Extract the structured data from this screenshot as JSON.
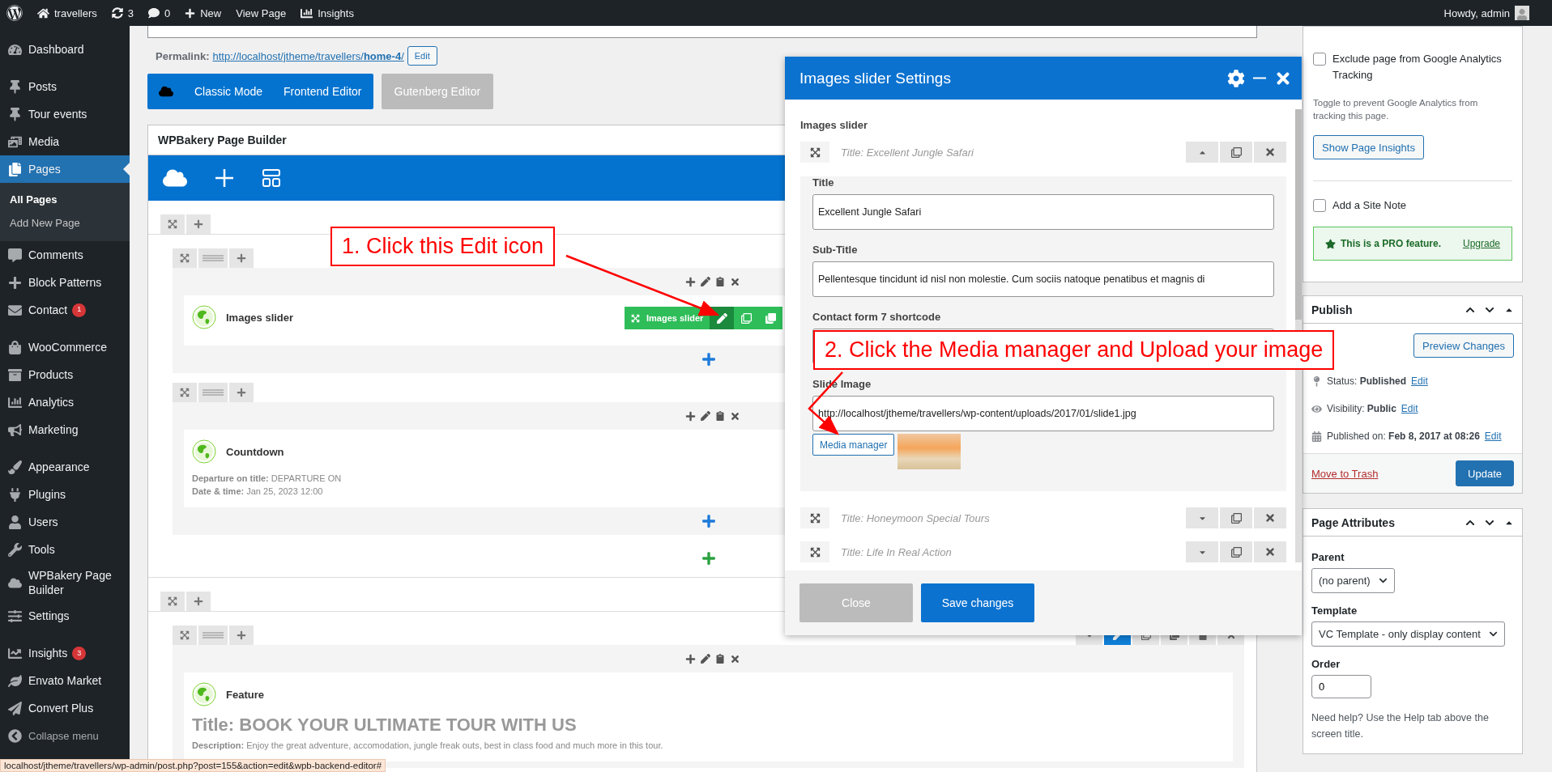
{
  "admin_bar": {
    "site": "travellers",
    "updates": "3",
    "comments": "0",
    "new": "New",
    "view": "View Page",
    "insights": "Insights",
    "greeting": "Howdy, admin"
  },
  "sidebar": {
    "groups": [
      {
        "items": [
          {
            "label": "Dashboard",
            "selected": false
          }
        ]
      },
      {
        "items": [
          {
            "label": "Posts",
            "selected": false
          },
          {
            "label": "Tour events",
            "selected": false
          },
          {
            "label": "Media",
            "selected": false
          },
          {
            "label": "Pages",
            "selected": true,
            "expanded": true,
            "children": [
              {
                "label": "All Pages",
                "selected": true
              },
              {
                "label": "Add New Page",
                "selected": false
              }
            ]
          },
          {
            "label": "Comments",
            "selected": false
          },
          {
            "label": "Block Patterns",
            "selected": false
          },
          {
            "label": "Contact",
            "selected": false,
            "badge": "1"
          }
        ]
      },
      {
        "items": [
          {
            "label": "WooCommerce",
            "selected": false
          },
          {
            "label": "Products",
            "selected": false
          },
          {
            "label": "Analytics",
            "selected": false
          },
          {
            "label": "Marketing",
            "selected": false
          }
        ]
      },
      {
        "items": [
          {
            "label": "Appearance",
            "selected": false
          },
          {
            "label": "Plugins",
            "selected": false
          },
          {
            "label": "Users",
            "selected": false
          },
          {
            "label": "Tools",
            "selected": false
          },
          {
            "label": "WPBakery Page Builder",
            "selected": false
          },
          {
            "label": "Settings",
            "selected": false
          }
        ]
      },
      {
        "items": [
          {
            "label": "Insights",
            "selected": false,
            "badge": "3"
          },
          {
            "label": "Envato Market",
            "selected": false
          },
          {
            "label": "Convert Plus",
            "selected": false
          }
        ]
      }
    ],
    "collapse": "Collapse menu"
  },
  "permalink": {
    "label": "Permalink:",
    "url": "http://localhost/jtheme/travellers/**home-4**/",
    "button": "Edit"
  },
  "mode_buttons": [
    {
      "label": "Classic Mode",
      "kind": "primary"
    },
    {
      "label": "Frontend Editor",
      "kind": "primary"
    },
    {
      "label": "Gutenberg Editor",
      "kind": "secondary"
    }
  ],
  "builder": {
    "title": "WPBakery Page Builder",
    "sections": [
      {
        "rows": [
          {
            "element": "Images slider",
            "hover_label": "Images slider",
            "params": []
          },
          {
            "element": "Countdown",
            "params": [
              {
                "label": "Departure on title:",
                "value": "DEPARTURE ON"
              },
              {
                "label": "Date & time:",
                "value": "Jan 25, 2023 12:00"
              }
            ]
          }
        ]
      },
      {
        "rows": [
          {
            "element": "Feature",
            "row_toolbar": true,
            "heading": "Title: BOOK YOUR ULTIMATE TOUR WITH US",
            "params": [
              {
                "label": "Description:",
                "value": "Enjoy the great adventure, accomodation, jungle freak outs, best in class food and much more in this tour."
              }
            ]
          }
        ]
      }
    ]
  },
  "monster": {
    "exclude_label": "Exclude page from Google Analytics Tracking",
    "exclude_checked": false,
    "hint": "Toggle to prevent Google Analytics from tracking this page.",
    "button": "Show Page Insights",
    "note_label": "Add a Site Note",
    "note_checked": false,
    "pro_text": "This is a PRO feature.",
    "pro_link": "Upgrade"
  },
  "publish": {
    "title": "Publish",
    "preview": "Preview Changes",
    "rows": [
      {
        "label": "Status:",
        "value": "Published",
        "link": "Edit"
      },
      {
        "label": "Visibility:",
        "value": "Public",
        "link": "Edit"
      },
      {
        "label": "Published on:",
        "value": "Feb 8, 2017 at 08:26",
        "link": "Edit"
      }
    ],
    "trash": "Move to Trash",
    "update": "Update"
  },
  "page_attributes": {
    "title": "Page Attributes",
    "parent_label": "Parent",
    "parent_value": "(no parent)",
    "template_label": "Template",
    "template_value": "VC Template - only display content",
    "order_label": "Order",
    "order_value": "0",
    "help": "Need help? Use the Help tab above the screen title."
  },
  "modal": {
    "title": "Images slider Settings",
    "param_label": "Images slider",
    "groups": [
      {
        "title": "Title: Excellent Jungle Safari",
        "expanded": true,
        "fields": [
          {
            "label": "Title",
            "value": "Excellent Jungle Safari"
          },
          {
            "label": "Sub-Title",
            "value": "Pellentesque tincidunt id nisl non molestie. Cum sociis natoque penatibus et magnis di"
          },
          {
            "label": "Contact form 7 shortcode"
          },
          {
            "label": "Slide Image",
            "value": "http://localhost/jtheme/travellers/wp-content/uploads/2017/01/slide1.jpg",
            "button": "Media manager",
            "thumbnail": true
          }
        ]
      },
      {
        "title": "Title: Honeymoon Special Tours",
        "expanded": false
      },
      {
        "title": "Title: Life In Real Action",
        "expanded": false
      }
    ],
    "buttons": [
      {
        "label": "Close",
        "kind": "secondary"
      },
      {
        "label": "Save changes",
        "kind": "primary"
      }
    ]
  },
  "annotations": [
    {
      "text": "1. Click this Edit icon"
    },
    {
      "text": "2. Click the Media manager and Upload your image"
    }
  ],
  "status_url": "localhost/jtheme/travellers/wp-admin/post.php?post=155&action=edit&wpb-backend-editor#"
}
